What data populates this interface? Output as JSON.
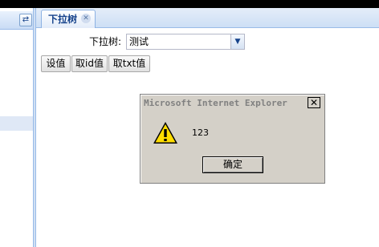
{
  "left_panel": {
    "tool_icon": "refresh-icon"
  },
  "tab": {
    "label": "下拉树",
    "close_icon": "close-icon"
  },
  "form": {
    "field_label": "下拉树:",
    "combo_value": "测试",
    "trigger_icon": "chevron-down-icon"
  },
  "buttons": {
    "set_value": "设值",
    "get_id": "取id值",
    "get_text": "取txt值"
  },
  "dialog": {
    "title": "Microsoft Internet Explorer",
    "message": "123",
    "ok_label": "确定",
    "icon": "warning-icon"
  }
}
